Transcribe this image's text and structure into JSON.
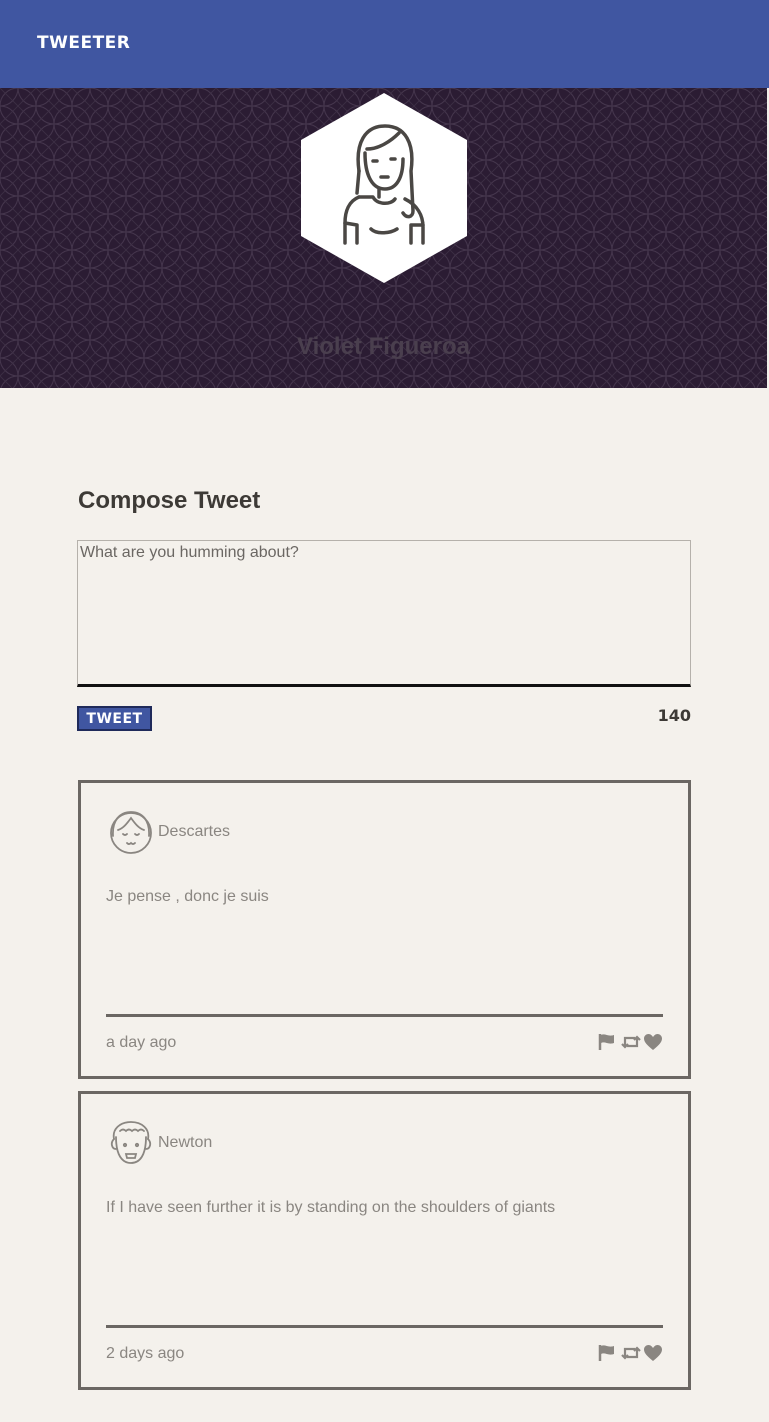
{
  "navbar": {
    "brand": "TWEETER",
    "color": "#4056a1"
  },
  "profile": {
    "name": "Violet Figueroa",
    "avatar_icon": "woman-avatar-icon"
  },
  "compose": {
    "title": "Compose Tweet",
    "placeholder": "What are you humming about?",
    "button_label": "TWEET",
    "counter": "140"
  },
  "tweets": [
    {
      "author": "Descartes",
      "avatar_icon": "descartes-avatar-icon",
      "text": "Je pense , donc je suis",
      "time": "a day ago"
    },
    {
      "author": "Newton",
      "avatar_icon": "newton-avatar-icon",
      "text": "If I have seen further it is by standing on the shoulders of giants",
      "time": "2 days ago"
    }
  ],
  "colors": {
    "accent": "#4056a1",
    "background": "#f4f1ec",
    "banner": "#2b1c33",
    "border": "#6b6763"
  }
}
